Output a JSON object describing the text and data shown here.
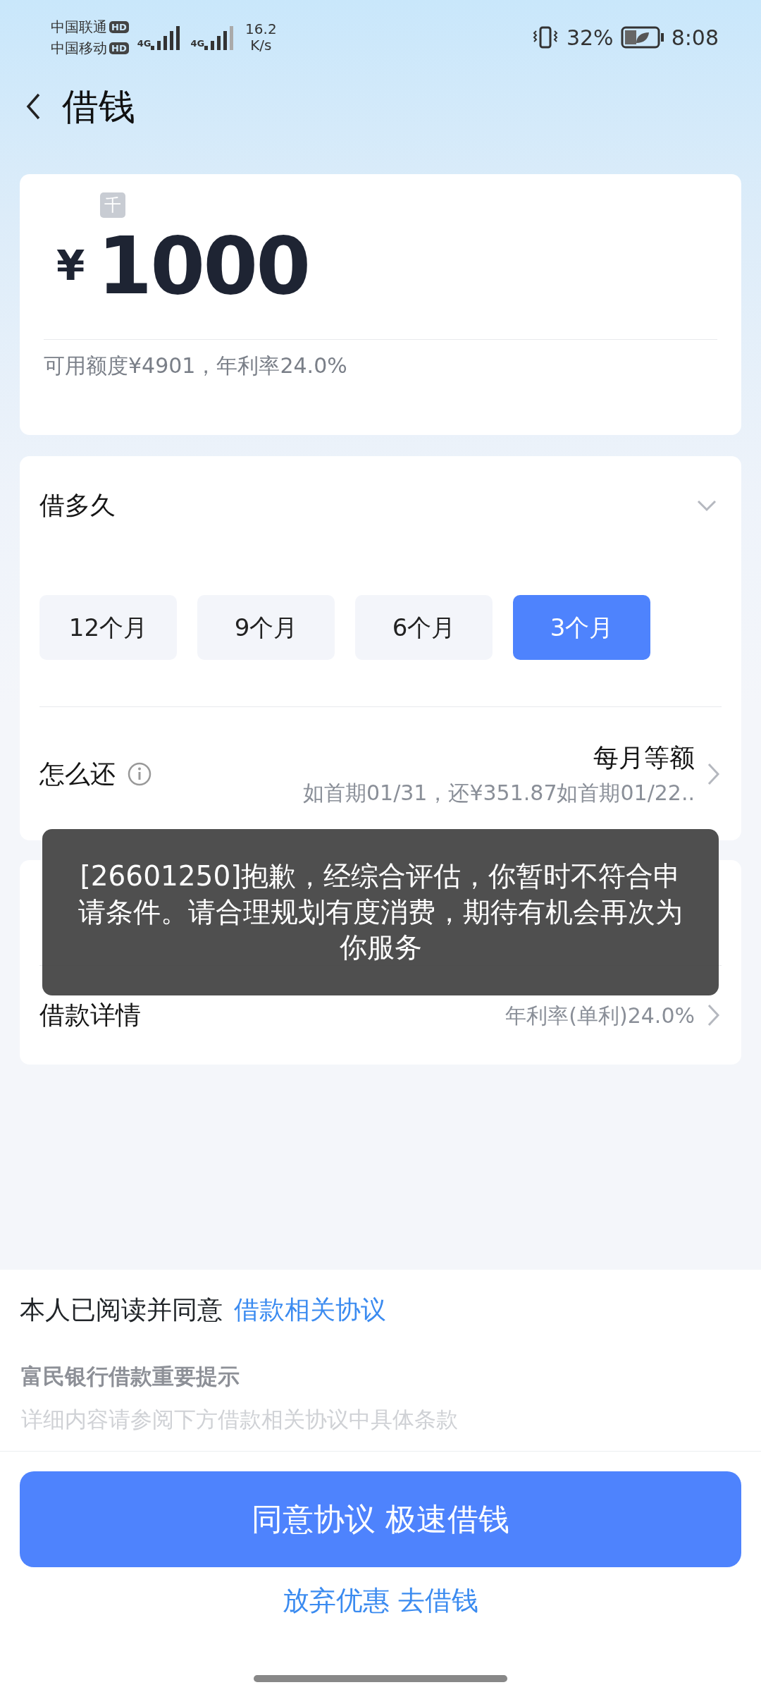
{
  "status_bar": {
    "carriers": [
      {
        "name": "中国联通",
        "badge": "HD"
      },
      {
        "name": "中国移动",
        "badge": "HD"
      }
    ],
    "networks": [
      {
        "label": "4G",
        "level": 1
      },
      {
        "label": "4G",
        "level": 0.8
      }
    ],
    "speed": [
      "16.2",
      "K/s"
    ],
    "battery": "32%",
    "time": "8:08"
  },
  "header": {
    "title": "借钱"
  },
  "amount_card": {
    "unit_tag": "千",
    "currency": "¥",
    "amount": "1000",
    "note": "可用额度¥4901，年利率24.0%"
  },
  "term_card": {
    "title": "借多久",
    "options": [
      {
        "label": "12个月",
        "selected": false
      },
      {
        "label": "9个月",
        "selected": false
      },
      {
        "label": "6个月",
        "selected": false
      },
      {
        "label": "3个月",
        "selected": true
      }
    ],
    "repay": {
      "label": "怎么还",
      "method": "每月等额",
      "detail": "如首期01/31，还¥351.87如首期01/22.."
    }
  },
  "detail_card": {
    "label": "借款详情",
    "value": "年利率(单利)24.0%"
  },
  "toast": "[26601250]抱歉，经综合评估，你暂时不符合申请条件。请合理规划有度消费，期待有机会再次为你服务",
  "agreement": {
    "text": "本人已阅读并同意",
    "link": "借款相关协议",
    "notice_title": "富民银行借款重要提示",
    "notice_text": "详细内容请参阅下方借款相关协议中具体条款"
  },
  "buttons": {
    "primary": "同意协议 极速借钱",
    "secondary": "放弃优惠 去借钱"
  }
}
